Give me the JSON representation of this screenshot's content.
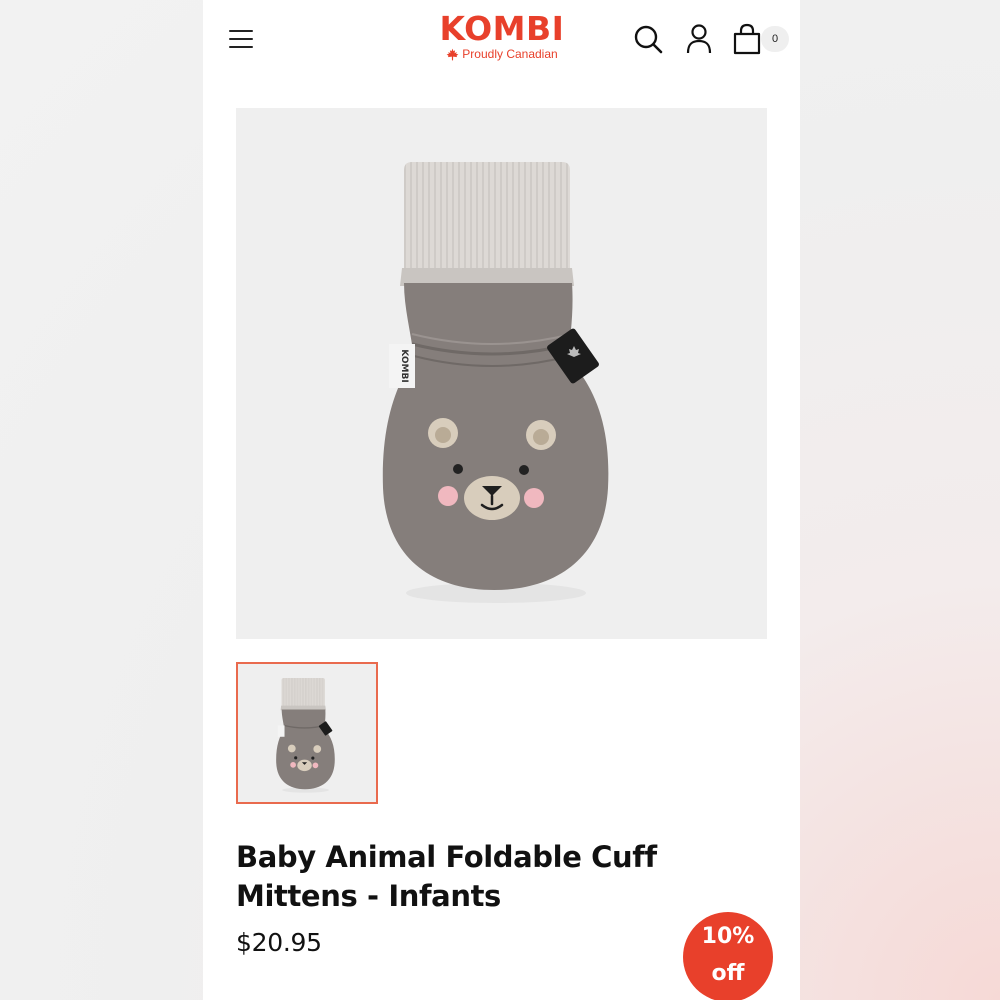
{
  "brand": {
    "name": "KOMBI",
    "tagline": "Proudly Canadian",
    "color": "#e8402b"
  },
  "header": {
    "menu_icon": "hamburger-icon",
    "search_icon": "search-icon",
    "account_icon": "user-icon",
    "cart_icon": "shopping-bag-icon",
    "cart_count": "0"
  },
  "gallery": {
    "main_image": "bear-mitten-image",
    "mitten_label": "KOMBI",
    "thumbnails": [
      "bear-mitten-thumbnail"
    ],
    "selected_border_color": "#e96a4e"
  },
  "product": {
    "title": "Baby Animal Foldable Cuff Mittens - Infants",
    "price": "$20.95"
  },
  "promo_badge": {
    "line1": "10%",
    "line2": "off",
    "color": "#e8402b"
  }
}
